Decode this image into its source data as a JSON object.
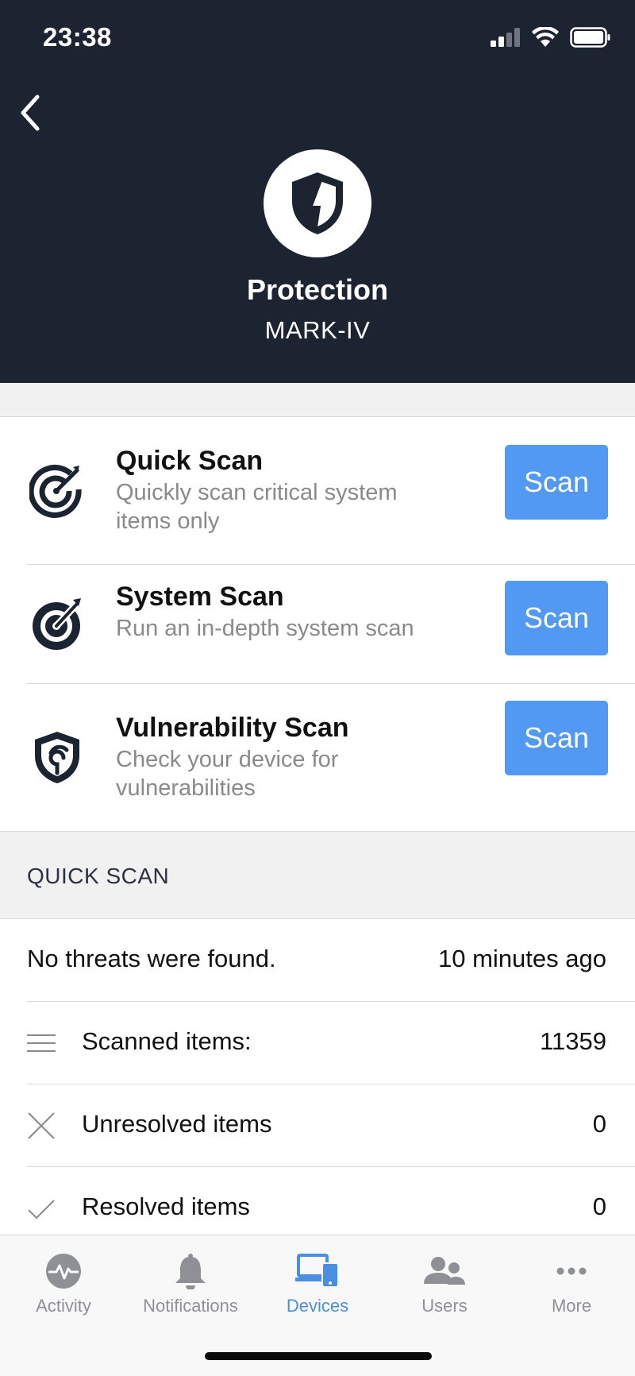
{
  "status_bar": {
    "time": "23:38"
  },
  "header": {
    "title": "Protection",
    "subtitle": "MARK-IV",
    "logo_icon": "shield-bolt-icon",
    "background": "#1c2331"
  },
  "scans": [
    {
      "title": "Quick Scan",
      "description": "Quickly scan critical system items only",
      "button": "Scan",
      "icon": "target-arrow-icon"
    },
    {
      "title": "System Scan",
      "description": "Run an in-depth system scan",
      "button": "Scan",
      "icon": "target-solid-icon"
    },
    {
      "title": "Vulnerability Scan",
      "description": "Check your device for vulnerabilities",
      "button": "Scan",
      "icon": "shield-spiral-icon"
    }
  ],
  "section_header": "QUICK SCAN",
  "results": {
    "summary": "No threats were found.",
    "time_ago": "10 minutes ago",
    "rows": [
      {
        "icon": "list-icon",
        "label": "Scanned items:",
        "value": "11359"
      },
      {
        "icon": "x-icon",
        "label": "Unresolved items",
        "value": "0"
      },
      {
        "icon": "check-icon",
        "label": "Resolved items",
        "value": "0"
      }
    ]
  },
  "tabs": [
    {
      "label": "Activity",
      "icon": "activity-icon",
      "active": false
    },
    {
      "label": "Notifications",
      "icon": "bell-icon",
      "active": false
    },
    {
      "label": "Devices",
      "icon": "devices-icon",
      "active": true
    },
    {
      "label": "Users",
      "icon": "users-icon",
      "active": false
    },
    {
      "label": "More",
      "icon": "more-icon",
      "active": false
    }
  ],
  "colors": {
    "accent": "#5199f2",
    "active_tab": "#4a8fe0",
    "muted": "#8e9096"
  }
}
